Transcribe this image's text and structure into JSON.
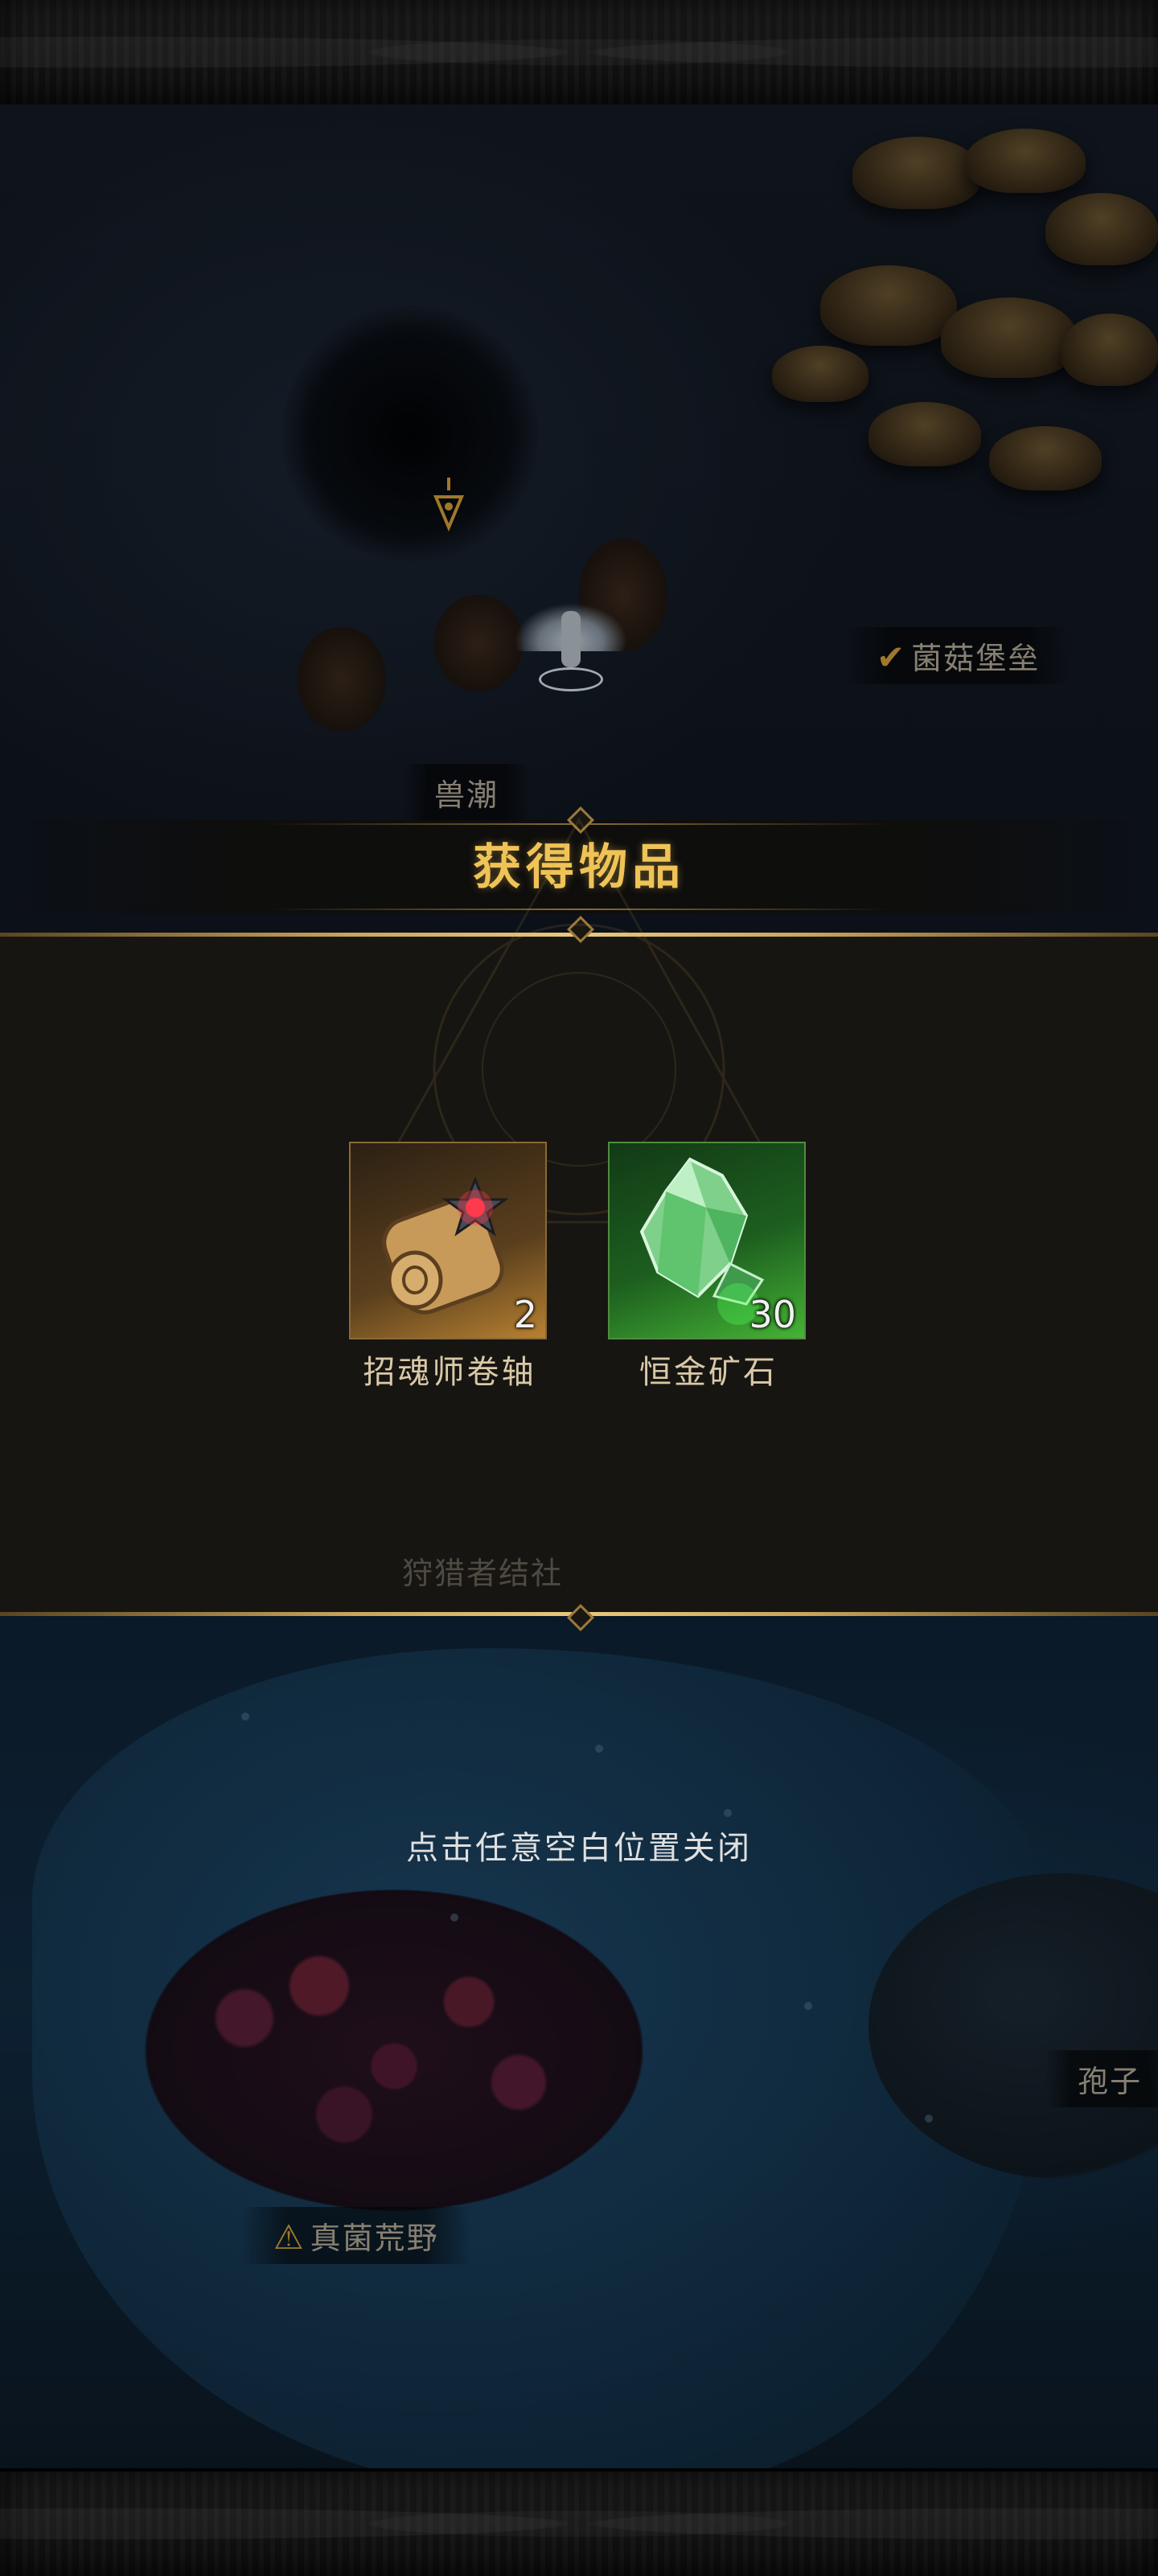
{
  "map": {
    "labels": {
      "mushroom_fort": "菌菇堡垒",
      "beast_tide": "兽潮",
      "hunter_guild": "狩猎者结社",
      "spore": "孢子",
      "fungus_wild": "真菌荒野"
    }
  },
  "reward_dialog": {
    "title": "获得物品",
    "items": [
      {
        "name": "招魂师卷轴",
        "quantity": "2",
        "rarity": "orange",
        "icon": "scroll-icon"
      },
      {
        "name": "恒金矿石",
        "quantity": "30",
        "rarity": "green",
        "icon": "ore-crystal-icon"
      }
    ]
  },
  "close_hint": "点击任意空白位置关闭",
  "colors": {
    "title_gold": "#f0c357",
    "border_gold": "#c9a45a",
    "marker_gold": "#d4a13a",
    "rarity_orange": "#b78132",
    "rarity_green": "#45b335"
  }
}
